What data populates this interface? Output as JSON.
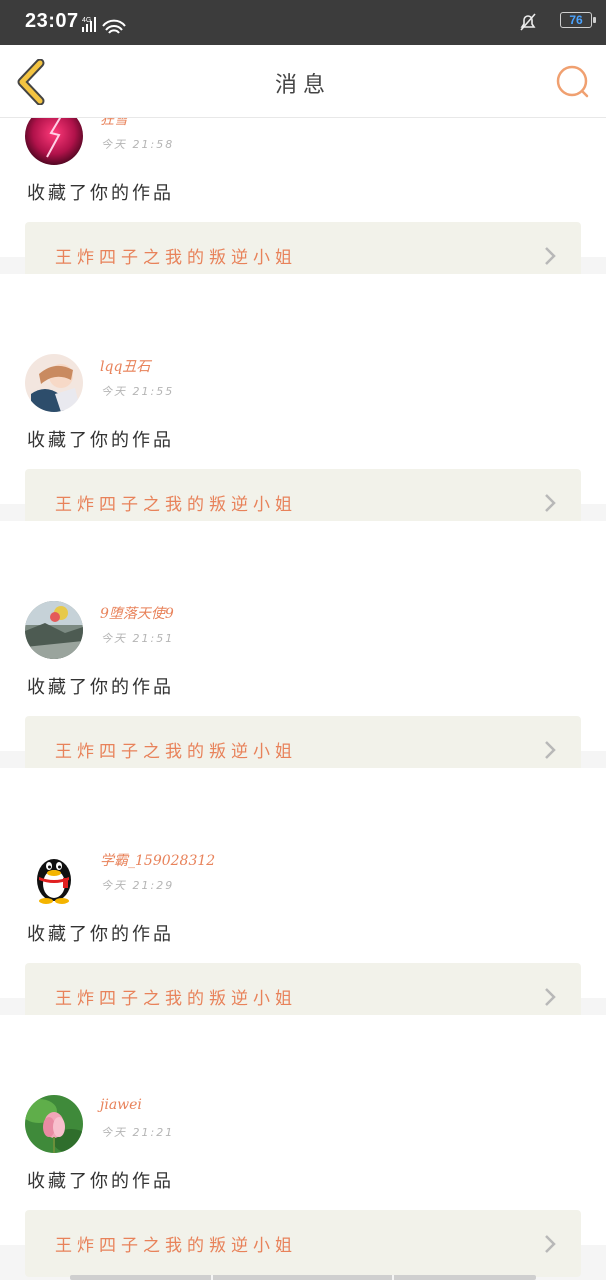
{
  "status_bar": {
    "time": "23:07",
    "network": "4G",
    "battery": "76"
  },
  "header": {
    "title": "消息",
    "back_icon": "chevron-left-icon",
    "search_icon": "search-icon"
  },
  "colors": {
    "accent": "#e8825a",
    "back_icon": "#f4c441",
    "card_link_bg": "#f2f2ea"
  },
  "messages": [
    {
      "username": "狂雪",
      "time": "今天 21:58",
      "action": "收藏了你的作品",
      "work_title": "王炸四子之我的叛逆小姐"
    },
    {
      "username": "lqq丑石",
      "time": "今天 21:55",
      "action": "收藏了你的作品",
      "work_title": "王炸四子之我的叛逆小姐"
    },
    {
      "username": "9堕落天使9",
      "time": "今天 21:51",
      "action": "收藏了你的作品",
      "work_title": "王炸四子之我的叛逆小姐"
    },
    {
      "username": "学霸_159028312",
      "time": "今天 21:29",
      "action": "收藏了你的作品",
      "work_title": "王炸四子之我的叛逆小姐"
    },
    {
      "username": "jiawei",
      "time": "今天 21:21",
      "action": "收藏了你的作品",
      "work_title": "王炸四子之我的叛逆小姐"
    }
  ]
}
